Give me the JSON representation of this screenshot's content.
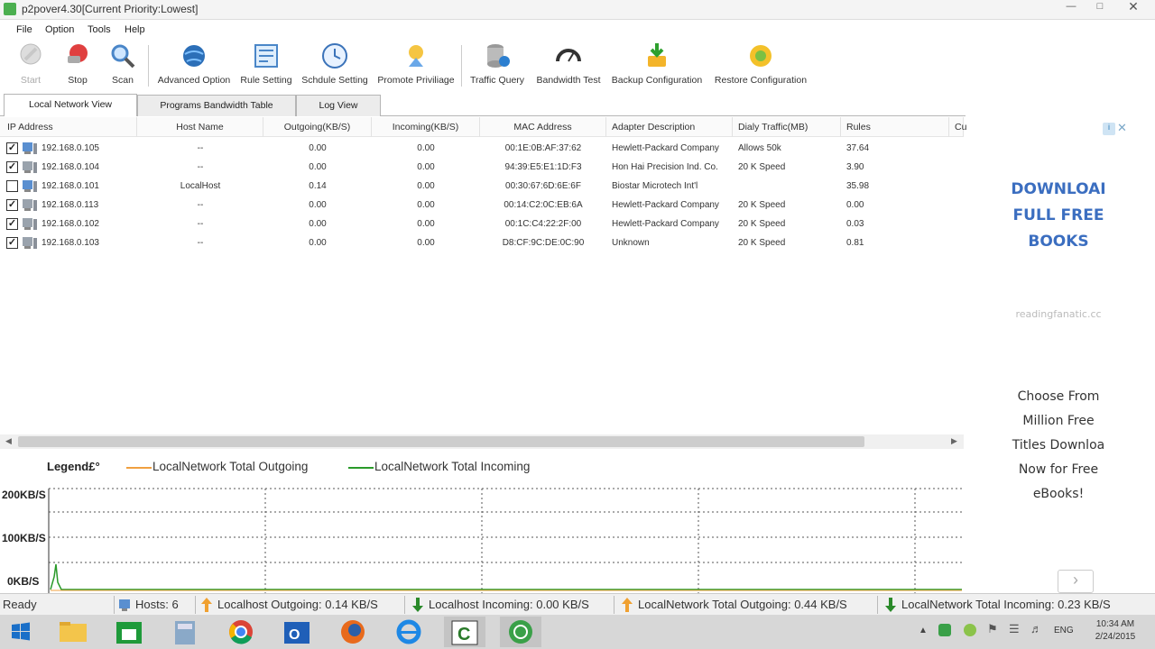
{
  "window": {
    "title": "p2pover4.30[Current Priority:Lowest]"
  },
  "menu": [
    "File",
    "Option",
    "Tools",
    "Help"
  ],
  "toolbar": [
    {
      "label": "Start",
      "icon": "start-icon",
      "enabled": false
    },
    {
      "label": "Stop",
      "icon": "stop-icon",
      "enabled": true
    },
    {
      "label": "Scan",
      "icon": "scan-icon",
      "enabled": true
    },
    {
      "label": "Advanced Option",
      "icon": "globe-icon",
      "enabled": true
    },
    {
      "label": "Rule Setting",
      "icon": "rule-icon",
      "enabled": true
    },
    {
      "label": "Schdule Setting",
      "icon": "clock-icon",
      "enabled": true
    },
    {
      "label": "Promote Priviliage",
      "icon": "promote-icon",
      "enabled": true
    },
    {
      "label": "Traffic Query",
      "icon": "database-icon",
      "enabled": true
    },
    {
      "label": "Bandwidth Test",
      "icon": "speedometer-icon",
      "enabled": true
    },
    {
      "label": "Backup Configuration",
      "icon": "backup-icon",
      "enabled": true
    },
    {
      "label": "Restore Configuration",
      "icon": "restore-icon",
      "enabled": true
    }
  ],
  "tabs": [
    "Local Network View",
    "Programs Bandwidth Table",
    "Log View"
  ],
  "table": {
    "columns": [
      "IP Address",
      "Host Name",
      "Outgoing(KB/S)",
      "Incoming(KB/S)",
      "MAC Address",
      "Adapter Description",
      "Dialy Traffic(MB)",
      "Rules",
      "Cu"
    ],
    "rows": [
      {
        "checked": true,
        "ip": "192.168.0.105",
        "host": "--",
        "out": "0.00",
        "in": "0.00",
        "mac": "00:1E:0B:AF:37:62",
        "adapter": "Hewlett-Packard Company",
        "traffic": "Allows 50k",
        "rules": "37.64"
      },
      {
        "checked": true,
        "ip": "192.168.0.104",
        "host": "--",
        "out": "0.00",
        "in": "0.00",
        "mac": "94:39:E5:E1:1D:F3",
        "adapter": "Hon Hai Precision Ind. Co.",
        "traffic": "20 K Speed",
        "rules": "3.90"
      },
      {
        "checked": false,
        "ip": "192.168.0.101",
        "host": "LocalHost",
        "out": "0.14",
        "in": "0.00",
        "mac": "00:30:67:6D:6E:6F",
        "adapter": "Biostar Microtech Int'l",
        "traffic": "",
        "rules": "35.98"
      },
      {
        "checked": true,
        "ip": "192.168.0.113",
        "host": "--",
        "out": "0.00",
        "in": "0.00",
        "mac": "00:14:C2:0C:EB:6A",
        "adapter": "Hewlett-Packard Company",
        "traffic": "20 K Speed",
        "rules": "0.00"
      },
      {
        "checked": true,
        "ip": "192.168.0.102",
        "host": "--",
        "out": "0.00",
        "in": "0.00",
        "mac": "00:1C:C4:22:2F:00",
        "adapter": "Hewlett-Packard Company",
        "traffic": "20 K Speed",
        "rules": "0.03"
      },
      {
        "checked": true,
        "ip": "192.168.0.103",
        "host": "--",
        "out": "0.00",
        "in": "0.00",
        "mac": "D8:CF:9C:DE:0C:90",
        "adapter": "Unknown",
        "traffic": "20 K Speed",
        "rules": "0.81"
      }
    ]
  },
  "graph": {
    "legend_title": "Legend£°",
    "legend_outgoing": "LocalNetwork Total Outgoing",
    "legend_incoming": "LocalNetwork Total Incoming",
    "outgoing_color": "#f0a040",
    "incoming_color": "#2a9a2a",
    "y_labels": [
      "200KB/S",
      "100KB/S",
      "0KB/S"
    ]
  },
  "ad": {
    "line1": "DOWNLOAI",
    "line2": "FULL FREE",
    "line3": "BOOKS",
    "site": "readingfanatic.cc",
    "body": [
      "Choose From",
      "Million Free",
      "Titles Downloa",
      "Now for Free",
      "eBooks!"
    ],
    "color": "#3b6ec0"
  },
  "status": {
    "ready": "Ready",
    "hosts": "Hosts: 6",
    "lh_out": "Localhost Outgoing: 0.14 KB/S",
    "lh_in": "Localhost Incoming: 0.00 KB/S",
    "ln_out": "LocalNetwork Total Outgoing: 0.44 KB/S",
    "ln_in": "LocalNetwork Total Incoming: 0.23 KB/S"
  },
  "taskbar": {
    "lang": "ENG",
    "time": "10:34 AM",
    "date": "2/24/2015"
  }
}
